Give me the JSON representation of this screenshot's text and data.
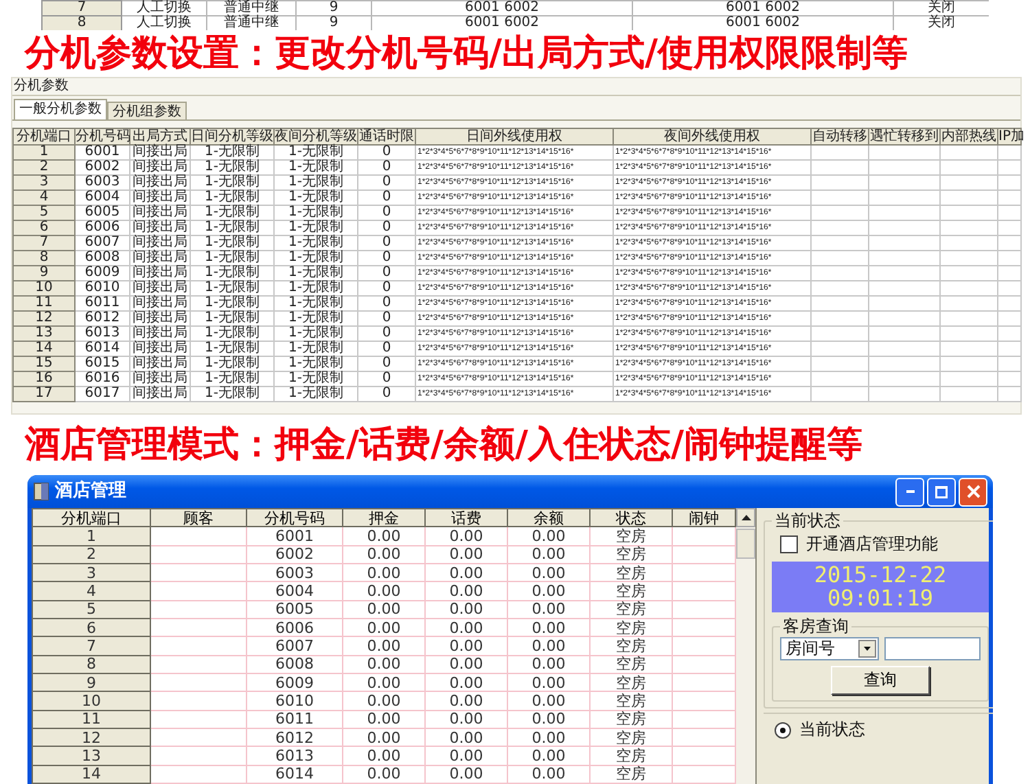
{
  "top_table": {
    "rows": [
      {
        "cells": [
          "7",
          "人工切换",
          "普通中继",
          "9",
          "6001 6002",
          "6001 6002",
          "关闭"
        ]
      },
      {
        "cells": [
          "8",
          "人工切换",
          "普通中继",
          "9",
          "6001 6002",
          "6001 6002",
          "关闭"
        ]
      }
    ]
  },
  "heading_1": "分机参数设置：更改分机号码/出局方式/使用权限限制等",
  "extension_panel": {
    "title": "分机参数",
    "tabs": [
      {
        "label": "一般分机参数",
        "selected": true
      },
      {
        "label": "分机组参数",
        "selected": false
      }
    ],
    "table": {
      "columns": [
        "分机端口",
        "分机号码",
        "出局方式",
        "日间分机等级",
        "夜间分机等级",
        "通话时限",
        "日间外线使用权",
        "夜间外线使用权",
        "自动转移",
        "遇忙转移到",
        "内部热线",
        "IP加"
      ],
      "rows": [
        {
          "cells": [
            "1",
            "6001",
            "间接出局",
            "1-无限制",
            "1-无限制",
            "0",
            "1*2*3*4*5*6*7*8*9*10*11*12*13*14*15*16*",
            "1*2*3*4*5*6*7*8*9*10*11*12*13*14*15*16*"
          ]
        },
        {
          "cells": [
            "2",
            "6002",
            "间接出局",
            "1-无限制",
            "1-无限制",
            "0",
            "1*2*3*4*5*6*7*8*9*10*11*12*13*14*15*16*",
            "1*2*3*4*5*6*7*8*9*10*11*12*13*14*15*16*"
          ]
        },
        {
          "cells": [
            "3",
            "6003",
            "间接出局",
            "1-无限制",
            "1-无限制",
            "0",
            "1*2*3*4*5*6*7*8*9*10*11*12*13*14*15*16*",
            "1*2*3*4*5*6*7*8*9*10*11*12*13*14*15*16*"
          ]
        },
        {
          "cells": [
            "4",
            "6004",
            "间接出局",
            "1-无限制",
            "1-无限制",
            "0",
            "1*2*3*4*5*6*7*8*9*10*11*12*13*14*15*16*",
            "1*2*3*4*5*6*7*8*9*10*11*12*13*14*15*16*"
          ]
        },
        {
          "cells": [
            "5",
            "6005",
            "间接出局",
            "1-无限制",
            "1-无限制",
            "0",
            "1*2*3*4*5*6*7*8*9*10*11*12*13*14*15*16*",
            "1*2*3*4*5*6*7*8*9*10*11*12*13*14*15*16*"
          ]
        },
        {
          "cells": [
            "6",
            "6006",
            "间接出局",
            "1-无限制",
            "1-无限制",
            "0",
            "1*2*3*4*5*6*7*8*9*10*11*12*13*14*15*16*",
            "1*2*3*4*5*6*7*8*9*10*11*12*13*14*15*16*"
          ]
        },
        {
          "cells": [
            "7",
            "6007",
            "间接出局",
            "1-无限制",
            "1-无限制",
            "0",
            "1*2*3*4*5*6*7*8*9*10*11*12*13*14*15*16*",
            "1*2*3*4*5*6*7*8*9*10*11*12*13*14*15*16*"
          ]
        },
        {
          "cells": [
            "8",
            "6008",
            "间接出局",
            "1-无限制",
            "1-无限制",
            "0",
            "1*2*3*4*5*6*7*8*9*10*11*12*13*14*15*16*",
            "1*2*3*4*5*6*7*8*9*10*11*12*13*14*15*16*"
          ]
        },
        {
          "cells": [
            "9",
            "6009",
            "间接出局",
            "1-无限制",
            "1-无限制",
            "0",
            "1*2*3*4*5*6*7*8*9*10*11*12*13*14*15*16*",
            "1*2*3*4*5*6*7*8*9*10*11*12*13*14*15*16*"
          ]
        },
        {
          "cells": [
            "10",
            "6010",
            "间接出局",
            "1-无限制",
            "1-无限制",
            "0",
            "1*2*3*4*5*6*7*8*9*10*11*12*13*14*15*16*",
            "1*2*3*4*5*6*7*8*9*10*11*12*13*14*15*16*"
          ]
        },
        {
          "cells": [
            "11",
            "6011",
            "间接出局",
            "1-无限制",
            "1-无限制",
            "0",
            "1*2*3*4*5*6*7*8*9*10*11*12*13*14*15*16*",
            "1*2*3*4*5*6*7*8*9*10*11*12*13*14*15*16*"
          ]
        },
        {
          "cells": [
            "12",
            "6012",
            "间接出局",
            "1-无限制",
            "1-无限制",
            "0",
            "1*2*3*4*5*6*7*8*9*10*11*12*13*14*15*16*",
            "1*2*3*4*5*6*7*8*9*10*11*12*13*14*15*16*"
          ]
        },
        {
          "cells": [
            "13",
            "6013",
            "间接出局",
            "1-无限制",
            "1-无限制",
            "0",
            "1*2*3*4*5*6*7*8*9*10*11*12*13*14*15*16*",
            "1*2*3*4*5*6*7*8*9*10*11*12*13*14*15*16*"
          ]
        },
        {
          "cells": [
            "14",
            "6014",
            "间接出局",
            "1-无限制",
            "1-无限制",
            "0",
            "1*2*3*4*5*6*7*8*9*10*11*12*13*14*15*16*",
            "1*2*3*4*5*6*7*8*9*10*11*12*13*14*15*16*"
          ]
        },
        {
          "cells": [
            "15",
            "6015",
            "间接出局",
            "1-无限制",
            "1-无限制",
            "0",
            "1*2*3*4*5*6*7*8*9*10*11*12*13*14*15*16*",
            "1*2*3*4*5*6*7*8*9*10*11*12*13*14*15*16*"
          ]
        },
        {
          "cells": [
            "16",
            "6016",
            "间接出局",
            "1-无限制",
            "1-无限制",
            "0",
            "1*2*3*4*5*6*7*8*9*10*11*12*13*14*15*16*",
            "1*2*3*4*5*6*7*8*9*10*11*12*13*14*15*16*"
          ]
        },
        {
          "cells": [
            "17",
            "6017",
            "间接出局",
            "1-无限制",
            "1-无限制",
            "0",
            "1*2*3*4*5*6*7*8*9*10*11*12*13*14*15*16*",
            "1*2*3*4*5*6*7*8*9*10*11*12*13*14*15*16*"
          ]
        }
      ]
    }
  },
  "heading_2": "酒店管理模式：押金/话费/余额/入住状态/闹钟提醒等",
  "hotel_window": {
    "title": "酒店管理",
    "table": {
      "columns": [
        "分机端口",
        "顾客",
        "分机号码",
        "押金",
        "话费",
        "余额",
        "状态",
        "闹钟"
      ],
      "rows": [
        {
          "port": "1",
          "number": "6001",
          "deposit": "0.00",
          "charge": "0.00",
          "balance": "0.00",
          "status": "空房"
        },
        {
          "port": "2",
          "number": "6002",
          "deposit": "0.00",
          "charge": "0.00",
          "balance": "0.00",
          "status": "空房"
        },
        {
          "port": "3",
          "number": "6003",
          "deposit": "0.00",
          "charge": "0.00",
          "balance": "0.00",
          "status": "空房"
        },
        {
          "port": "4",
          "number": "6004",
          "deposit": "0.00",
          "charge": "0.00",
          "balance": "0.00",
          "status": "空房"
        },
        {
          "port": "5",
          "number": "6005",
          "deposit": "0.00",
          "charge": "0.00",
          "balance": "0.00",
          "status": "空房"
        },
        {
          "port": "6",
          "number": "6006",
          "deposit": "0.00",
          "charge": "0.00",
          "balance": "0.00",
          "status": "空房"
        },
        {
          "port": "7",
          "number": "6007",
          "deposit": "0.00",
          "charge": "0.00",
          "balance": "0.00",
          "status": "空房"
        },
        {
          "port": "8",
          "number": "6008",
          "deposit": "0.00",
          "charge": "0.00",
          "balance": "0.00",
          "status": "空房"
        },
        {
          "port": "9",
          "number": "6009",
          "deposit": "0.00",
          "charge": "0.00",
          "balance": "0.00",
          "status": "空房"
        },
        {
          "port": "10",
          "number": "6010",
          "deposit": "0.00",
          "charge": "0.00",
          "balance": "0.00",
          "status": "空房"
        },
        {
          "port": "11",
          "number": "6011",
          "deposit": "0.00",
          "charge": "0.00",
          "balance": "0.00",
          "status": "空房"
        },
        {
          "port": "12",
          "number": "6012",
          "deposit": "0.00",
          "charge": "0.00",
          "balance": "0.00",
          "status": "空房"
        },
        {
          "port": "13",
          "number": "6013",
          "deposit": "0.00",
          "charge": "0.00",
          "balance": "0.00",
          "status": "空房"
        },
        {
          "port": "14",
          "number": "6014",
          "deposit": "0.00",
          "charge": "0.00",
          "balance": "0.00",
          "status": "空房"
        }
      ]
    },
    "status_group": {
      "title": "当前状态",
      "checkbox": {
        "label": "开通酒店管理功能",
        "checked": false
      },
      "date": "2015-12-22",
      "time": "09:01:19"
    },
    "room_query": {
      "title": "客房查询",
      "dropdown": "房间号",
      "button": "查询"
    },
    "view_options": [
      {
        "label": "当前状态",
        "selected": true
      }
    ]
  }
}
